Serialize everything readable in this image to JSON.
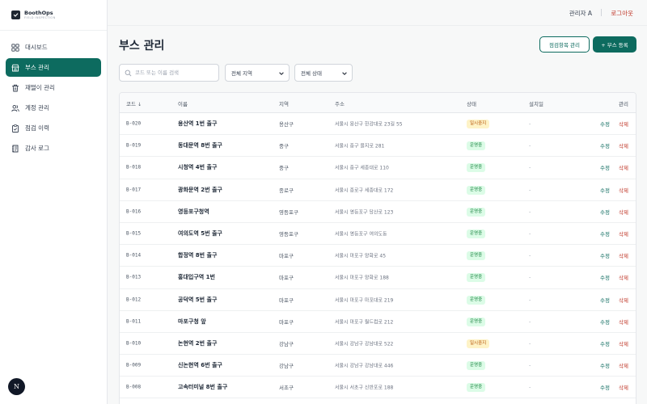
{
  "brand": {
    "name": "BoothOps",
    "subtitle": "FIELD INSPECTION"
  },
  "sidebar": {
    "items": [
      {
        "label": "대시보드",
        "icon": "grid-icon",
        "active": false
      },
      {
        "label": "부스 관리",
        "icon": "booth-icon",
        "active": true
      },
      {
        "label": "재떨이 관리",
        "icon": "trash-icon",
        "active": false
      },
      {
        "label": "계정 관리",
        "icon": "users-icon",
        "active": false
      },
      {
        "label": "점검 이력",
        "icon": "clipboard-check-icon",
        "active": false
      },
      {
        "label": "감사 로그",
        "icon": "log-icon",
        "active": false
      }
    ],
    "avatar_letter": "N"
  },
  "topbar": {
    "user": "관리자 A",
    "logout": "로그아웃"
  },
  "page": {
    "title": "부스 관리",
    "btn_checklist": "점검항목 관리",
    "btn_register": "+ 부스 등록"
  },
  "filters": {
    "search_placeholder": "코드 또는 이름 검색",
    "region": "전체 지역",
    "status": "전체 상태"
  },
  "table": {
    "headers": {
      "code": "코드",
      "sort_indicator": "↓",
      "name": "이름",
      "region": "지역",
      "address": "주소",
      "status": "상태",
      "installed": "설치일",
      "manage": "관리"
    },
    "edit_label": "수정",
    "delete_label": "삭제",
    "rows": [
      {
        "code": "B-020",
        "name": "용산역 1번 출구",
        "region": "용산구",
        "address": "서울시 용산구 한강대로 23길 55",
        "status": "일시중지",
        "installed": "-"
      },
      {
        "code": "B-019",
        "name": "동대문역 8번 출구",
        "region": "중구",
        "address": "서울시 중구 을지로 281",
        "status": "운영중",
        "installed": "-"
      },
      {
        "code": "B-018",
        "name": "시청역 4번 출구",
        "region": "중구",
        "address": "서울시 중구 세종대로 110",
        "status": "운영중",
        "installed": "-"
      },
      {
        "code": "B-017",
        "name": "광화문역 2번 출구",
        "region": "종로구",
        "address": "서울시 종로구 세종대로 172",
        "status": "운영중",
        "installed": "-"
      },
      {
        "code": "B-016",
        "name": "영등포구청역",
        "region": "영등포구",
        "address": "서울시 영등포구 당산로 123",
        "status": "운영중",
        "installed": "-"
      },
      {
        "code": "B-015",
        "name": "여의도역 5번 출구",
        "region": "영등포구",
        "address": "서울시 영등포구 여의도동",
        "status": "운영중",
        "installed": "-"
      },
      {
        "code": "B-014",
        "name": "합정역 8번 출구",
        "region": "마포구",
        "address": "서울시 마포구 양화로 45",
        "status": "운영중",
        "installed": "-"
      },
      {
        "code": "B-013",
        "name": "홍대입구역 1번",
        "region": "마포구",
        "address": "서울시 마포구 양화로 188",
        "status": "운영중",
        "installed": "-"
      },
      {
        "code": "B-012",
        "name": "공덕역 5번 출구",
        "region": "마포구",
        "address": "서울시 마포구 마포대로 219",
        "status": "운영중",
        "installed": "-"
      },
      {
        "code": "B-011",
        "name": "마포구청 앞",
        "region": "마포구",
        "address": "서울시 마포구 월드컵로 212",
        "status": "운영중",
        "installed": "-"
      },
      {
        "code": "B-010",
        "name": "논현역 2번 출구",
        "region": "강남구",
        "address": "서울시 강남구 강남대로 522",
        "status": "일시중지",
        "installed": "-"
      },
      {
        "code": "B-009",
        "name": "신논현역 6번 출구",
        "region": "강남구",
        "address": "서울시 강남구 강남대로 446",
        "status": "운영중",
        "installed": "-"
      },
      {
        "code": "B-008",
        "name": "고속터미널 8번 출구",
        "region": "서초구",
        "address": "서울시 서초구 신반포로 188",
        "status": "운영중",
        "installed": "-"
      }
    ]
  },
  "colors": {
    "accent": "#0d6b5f",
    "danger": "#c0392b",
    "ok_bg": "#dcfce7",
    "pause_bg": "#fef3c7"
  }
}
